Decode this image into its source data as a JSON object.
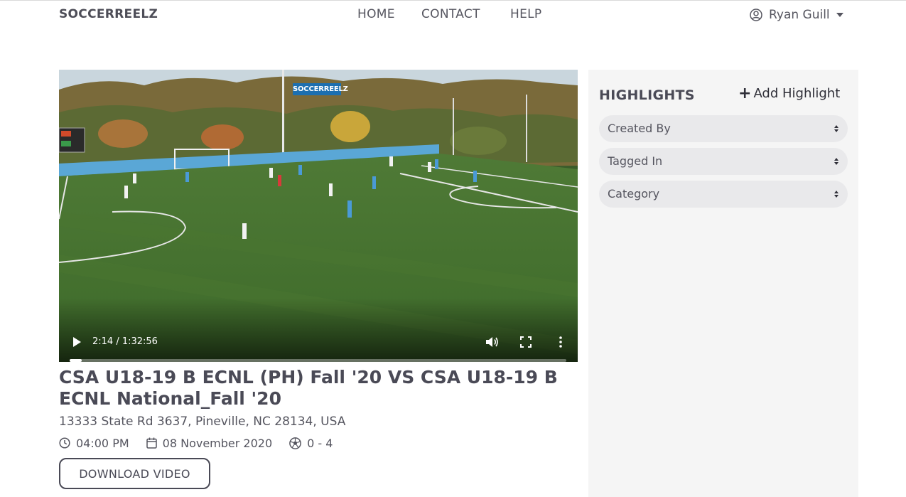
{
  "navbar": {
    "brand": "SOCCERREELZ",
    "links": [
      "HOME",
      "CONTACT",
      "HELP"
    ],
    "user_name": "Ryan Guill"
  },
  "video": {
    "watermark": "SOCCERREELZ",
    "time_display": "2:14 / 1:32:56",
    "progress_fraction": 0.024
  },
  "match": {
    "title": "CSA U18-19 B ECNL (PH) Fall '20 VS CSA U18-19 B ECNL National_Fall '20",
    "address": "13333 State Rd 3637, Pineville, NC 28134, USA",
    "time": "04:00 PM",
    "date": "08 November 2020",
    "score": "0 - 4",
    "download_label": "DOWNLOAD VIDEO"
  },
  "highlights": {
    "title": "HIGHLIGHTS",
    "add_label": "Add Highlight",
    "filters": [
      "Created By",
      "Tagged In",
      "Category"
    ]
  },
  "colors": {
    "text_dark": "#4a4a56",
    "panel_bg": "#f5f5f5",
    "filter_bg": "#e9e9eb",
    "watermark_bg": "#1c6fb0"
  }
}
